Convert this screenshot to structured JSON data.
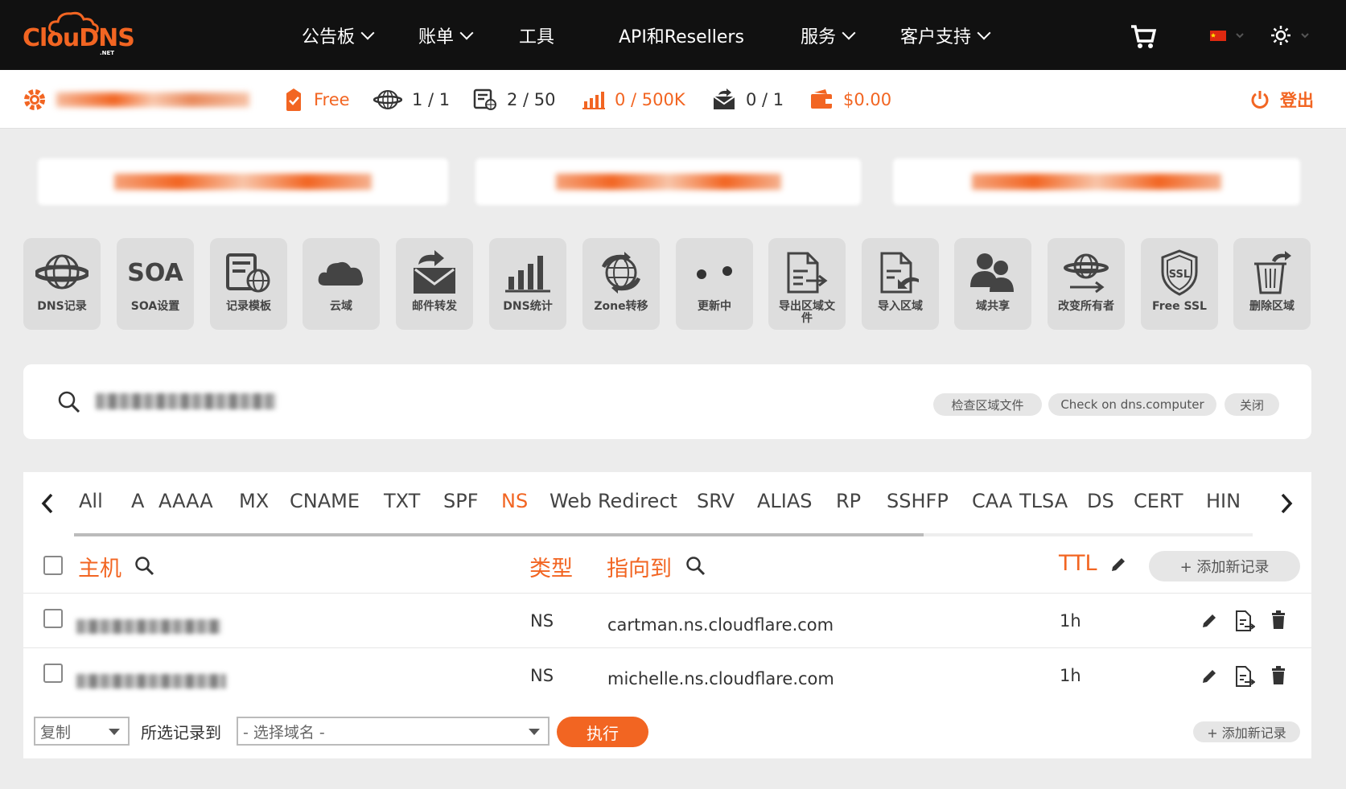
{
  "brand": {
    "logo_text": "ClouDNS",
    "logo_sub": ".NET"
  },
  "nav": {
    "items": [
      {
        "label": "公告板",
        "dropdown": true
      },
      {
        "label": "账单",
        "dropdown": true
      },
      {
        "label": "工具",
        "dropdown": false
      },
      {
        "label": "API和Resellers",
        "dropdown": false
      },
      {
        "label": "服务",
        "dropdown": true
      },
      {
        "label": "客户支持",
        "dropdown": true
      }
    ]
  },
  "status": {
    "plan": "Free",
    "zones": "1 / 1",
    "records": "2 / 50",
    "queries": "0 / 500K",
    "mail_forwards": "0 / 1",
    "balance": "$0.00",
    "logout": "登出"
  },
  "tiles": [
    {
      "label": "DNS记录",
      "icon": "globe-icon"
    },
    {
      "label": "SOA设置",
      "icon": "soa-text-icon",
      "icon_text": "SOA"
    },
    {
      "label": "记录模板",
      "icon": "template-icon"
    },
    {
      "label": "云域",
      "icon": "cloud-icon"
    },
    {
      "label": "邮件转发",
      "icon": "mail-forward-icon"
    },
    {
      "label": "DNS统计",
      "icon": "stats-icon"
    },
    {
      "label": "Zone转移",
      "icon": "zone-transfer-icon"
    },
    {
      "label": "更新中",
      "icon": "updating-icon"
    },
    {
      "label": "导出区域文件",
      "icon": "export-icon"
    },
    {
      "label": "导入区域",
      "icon": "import-icon"
    },
    {
      "label": "域共享",
      "icon": "share-icon"
    },
    {
      "label": "改变所有者",
      "icon": "change-owner-icon"
    },
    {
      "label": "Free SSL",
      "icon": "ssl-icon",
      "icon_text": "SSL"
    },
    {
      "label": "删除区域",
      "icon": "delete-zone-icon"
    }
  ],
  "search_panel": {
    "check_zone_label": "检查区域文件",
    "check_dns_label": "Check on dns.computer",
    "close_label": "关闭"
  },
  "record_types": {
    "tabs": [
      "All",
      "A",
      "AAAA",
      "MX",
      "CNAME",
      "TXT",
      "SPF",
      "NS",
      "Web Redirect",
      "SRV",
      "ALIAS",
      "RP",
      "SSHFP",
      "CAA",
      "TLSA",
      "DS",
      "CERT",
      "HIN"
    ],
    "active": "NS"
  },
  "table": {
    "headers": {
      "host": "主机",
      "type": "类型",
      "points_to": "指向到",
      "ttl": "TTL",
      "add_record": "+ 添加新记录"
    },
    "rows": [
      {
        "type": "NS",
        "points_to": "cartman.ns.cloudflare.com",
        "ttl": "1h"
      },
      {
        "type": "NS",
        "points_to": "michelle.ns.cloudflare.com",
        "ttl": "1h"
      }
    ]
  },
  "bottom": {
    "action_value": "复制",
    "selected_label": "所选记录到",
    "domain_placeholder": "- 选择域名 -",
    "execute_label": "执行",
    "add_record_label": "+ 添加新记录"
  },
  "colors": {
    "accent": "#f26522",
    "nav_bg": "#111111",
    "page_bg": "#ececec",
    "tile_bg": "#dddddd"
  }
}
